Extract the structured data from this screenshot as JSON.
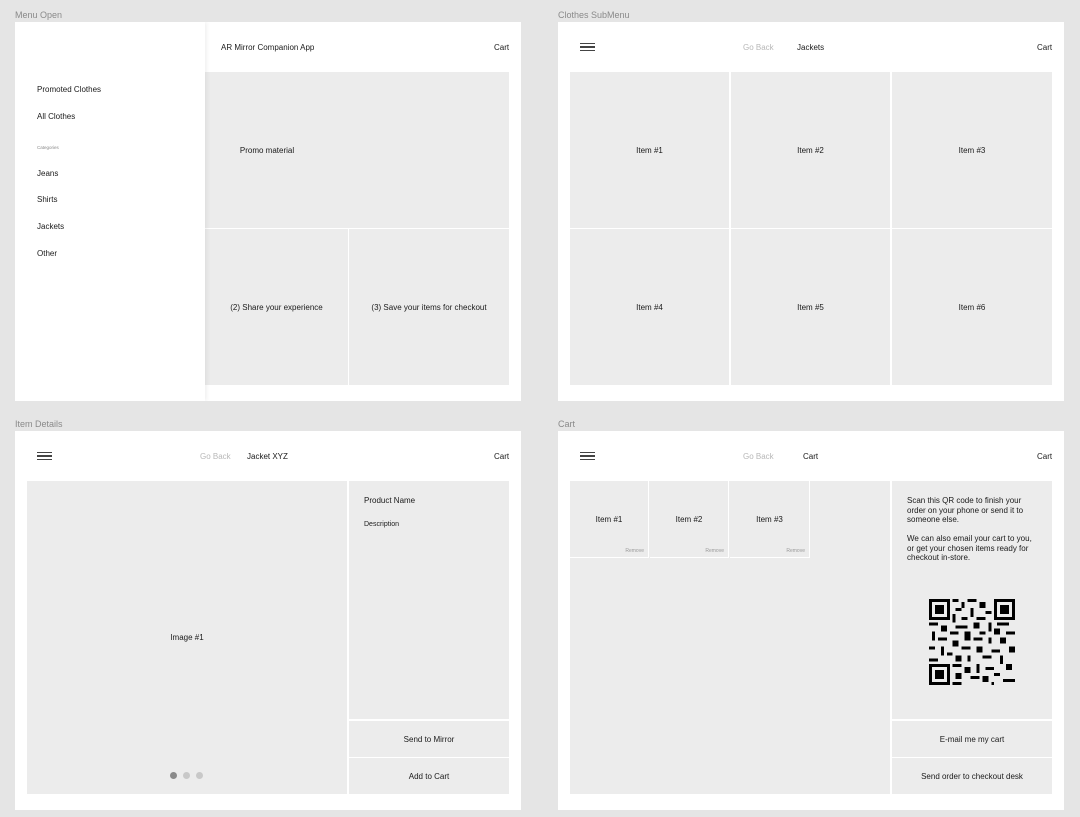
{
  "frames": {
    "menu_open": {
      "label": "Menu Open",
      "app_title": "AR Mirror Companion App",
      "cart": "Cart",
      "menu": {
        "promoted": "Promoted Clothes",
        "all": "All Clothes",
        "categories_heading": "Categories",
        "categories": [
          "Jeans",
          "Shirts",
          "Jackets",
          "Other"
        ]
      },
      "promo": "Promo material",
      "share": "(2) Share your experience",
      "save": "(3) Save your items for checkout"
    },
    "clothes_submenu": {
      "label": "Clothes SubMenu",
      "go_back": "Go Back",
      "title": "Jackets",
      "cart": "Cart",
      "items": [
        "Item #1",
        "Item #2",
        "Item #3",
        "Item #4",
        "Item #5",
        "Item #6"
      ]
    },
    "item_details": {
      "label": "Item Details",
      "go_back": "Go Back",
      "title": "Jacket XYZ",
      "cart": "Cart",
      "image": "Image #1",
      "product_name": "Product Name",
      "description": "Description",
      "send_to_mirror": "Send to Mirror",
      "add_to_cart": "Add to Cart",
      "carousel": {
        "count": 3,
        "active": 1
      }
    },
    "cart": {
      "label": "Cart",
      "go_back": "Go Back",
      "title": "Cart",
      "cart": "Cart",
      "items": [
        "Item #1",
        "Item #2",
        "Item #3"
      ],
      "remove": "Remove",
      "scan_text": "Scan this QR code to finish your order on your phone or send it to someone else.",
      "email_text": "We can also email your cart to you, or get your chosen items ready for checkout in-store.",
      "email_button": "E-mail me my cart",
      "send_button": "Send order to checkout desk"
    }
  },
  "colors": {
    "background": "#e5e5e5",
    "frame": "#ffffff",
    "panel": "#ececec",
    "muted": "#b8b8b8"
  }
}
